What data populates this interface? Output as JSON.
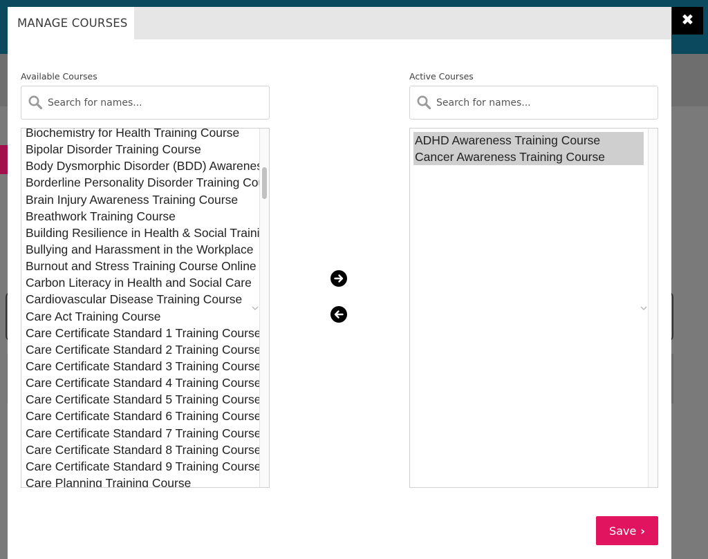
{
  "modal": {
    "title": "MANAGE COURSES",
    "close_symbol": "✖"
  },
  "available": {
    "label": "Available Courses",
    "search_placeholder": "Search for names...",
    "items": [
      "Biochemistry for Health Training Course",
      "Bipolar Disorder Training Course",
      "Body Dysmorphic Disorder (BDD) Awareness",
      "Borderline Personality Disorder Training Course",
      "Brain Injury Awareness Training Course",
      "Breathwork Training Course",
      "Building Resilience in Health & Social Training",
      "Bullying and Harassment in the Workplace",
      "Burnout and Stress Training Course Online",
      "Carbon Literacy in Health and Social Care",
      "Cardiovascular Disease Training Course",
      "Care Act Training Course",
      "Care Certificate Standard 1 Training Course",
      "Care Certificate Standard 2 Training Course",
      "Care Certificate Standard 3 Training Course",
      "Care Certificate Standard 4 Training Course",
      "Care Certificate Standard 5 Training Course",
      "Care Certificate Standard 6 Training Course",
      "Care Certificate Standard 7 Training Course",
      "Care Certificate Standard 8 Training Course",
      "Care Certificate Standard 9 Training Course",
      "Care Planning Training Course"
    ]
  },
  "active": {
    "label": "Active Courses",
    "search_placeholder": "Search for names...",
    "items": [
      "ADHD Awareness Training Course",
      "Cancer Awareness Training Course"
    ]
  },
  "actions": {
    "save_label": "Save",
    "save_chevron": "›",
    "move_right_icon": "arrow-right-icon",
    "move_left_icon": "arrow-left-icon"
  },
  "colors": {
    "header_bg": "#0b4a5e",
    "save_bg": "#e0145f",
    "selected_bg": "#cfcfcf"
  }
}
